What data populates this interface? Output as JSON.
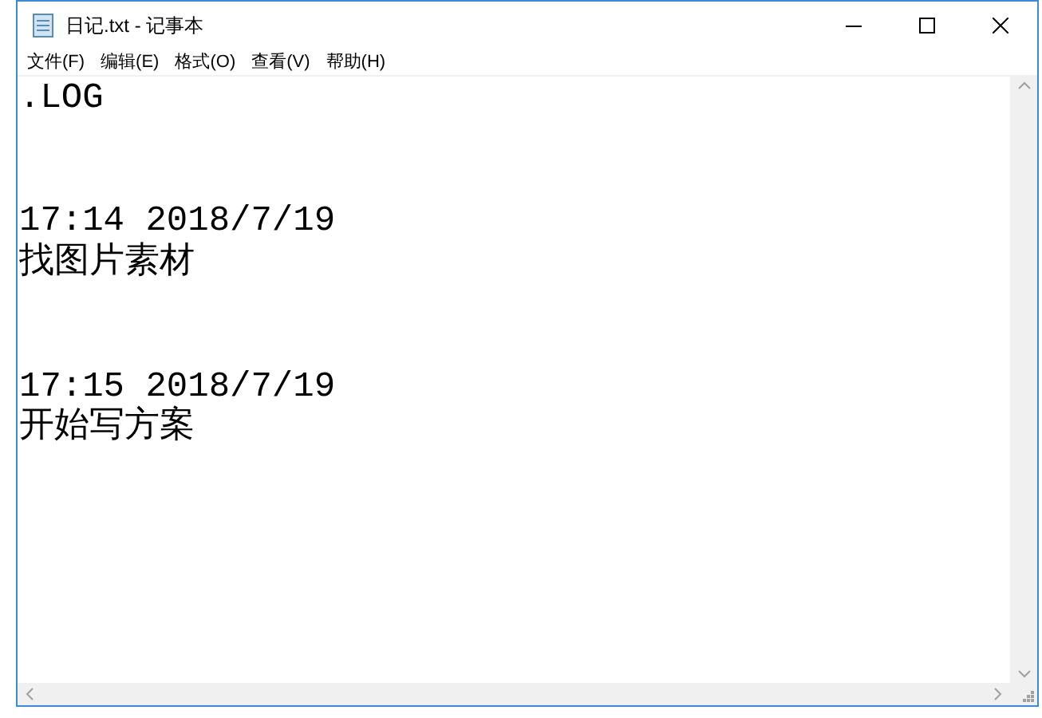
{
  "window": {
    "title": "日记.txt - 记事本"
  },
  "menu": [
    {
      "label": "文件(F)"
    },
    {
      "label": "编辑(E)"
    },
    {
      "label": "格式(O)"
    },
    {
      "label": "查看(V)"
    },
    {
      "label": "帮助(H)"
    }
  ],
  "document": {
    "text": ".LOG\n\n\n17:14 2018/7/19\n找图片素材\n\n\n17:15 2018/7/19\n开始写方案"
  }
}
